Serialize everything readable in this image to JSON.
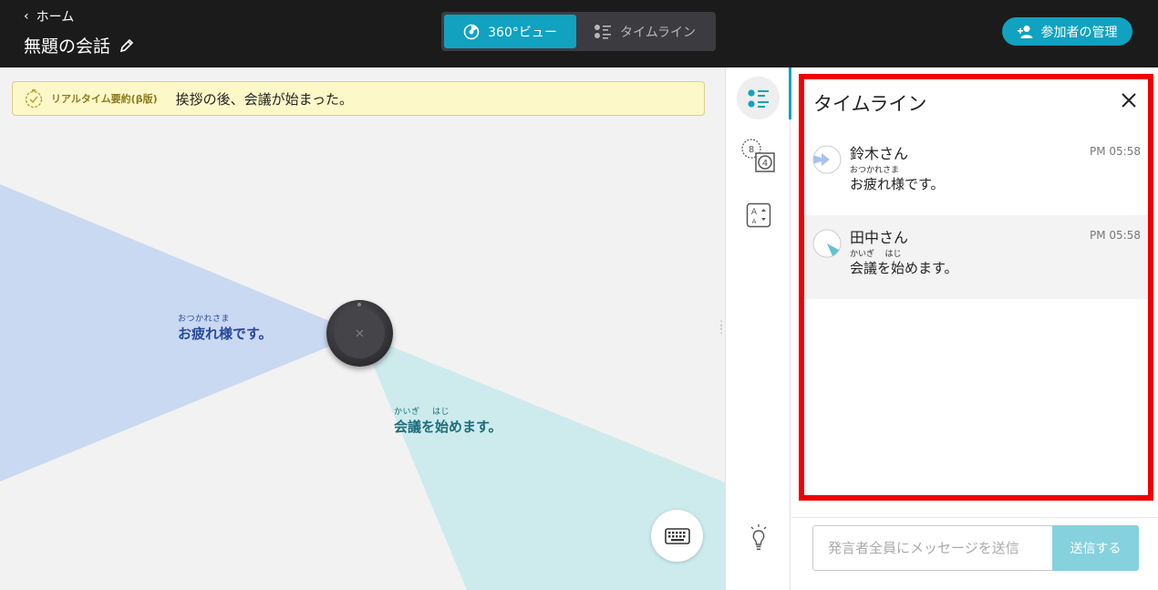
{
  "header": {
    "back_label": "ホーム",
    "title": "無題の会話",
    "view_tabs": [
      {
        "label": "360°ビュー",
        "active": true
      },
      {
        "label": "タイムライン",
        "active": false
      }
    ],
    "manage_label": "参加者の管理",
    "accent_color": "#10a2c0"
  },
  "summary": {
    "label": "リアルタイム要約(β版)",
    "text": "挨拶の後、会議が始まった。"
  },
  "viz": {
    "bubbles": [
      {
        "kana": "おつかれさま",
        "text": "お疲れ様です。",
        "color": "#27479a"
      },
      {
        "kana": "かいぎ    はじ",
        "text": "会議を始めます。",
        "color": "#1d6d7a"
      }
    ]
  },
  "timeline": {
    "title": "タイムライン",
    "entries": [
      {
        "speaker": "鈴木さん",
        "time": "PM 05:58",
        "kana": "おつかれさま",
        "message": "お疲れ様です。"
      },
      {
        "speaker": "田中さん",
        "time": "PM 05:58",
        "kana": "かいぎ    はじ",
        "message": "会議を始めます。"
      }
    ]
  },
  "message_bar": {
    "placeholder": "発言者全員にメッセージを送信",
    "send_label": "送信する"
  }
}
